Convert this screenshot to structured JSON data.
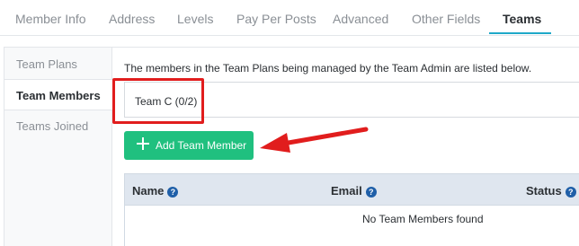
{
  "tabs": [
    {
      "label": "Member Info"
    },
    {
      "label": "Address"
    },
    {
      "label": "Levels"
    },
    {
      "label": "Pay Per Posts"
    },
    {
      "label": "Advanced"
    },
    {
      "label": "Other Fields"
    },
    {
      "label": "Teams",
      "active": true
    }
  ],
  "sidebar": {
    "items": [
      {
        "label": "Team Plans"
      },
      {
        "label": "Team Members",
        "active": true
      },
      {
        "label": "Teams Joined"
      }
    ]
  },
  "main": {
    "description": "The members in the Team Plans being managed by the Team Admin are listed below.",
    "team_select_value": "Team C (0/2)",
    "add_button_label": "Add Team Member",
    "table": {
      "columns": [
        {
          "label": "Name",
          "help_icon": "?"
        },
        {
          "label": "Email",
          "help_icon": "?"
        },
        {
          "label": "Status",
          "help_icon": "?"
        }
      ],
      "empty_message": "No Team Members found"
    }
  },
  "colors": {
    "accent_tab_underline": "#1fa9c9",
    "add_button": "#20c07f",
    "annotation_red": "#e11d1d",
    "table_header_bg": "#dfe6ef",
    "help_icon": "#1f5fa8"
  },
  "icons": {
    "add_button_icon": "plus-icon",
    "column_help_icon": "help-circle-icon",
    "annotation_arrow": "arrow-left-icon"
  }
}
